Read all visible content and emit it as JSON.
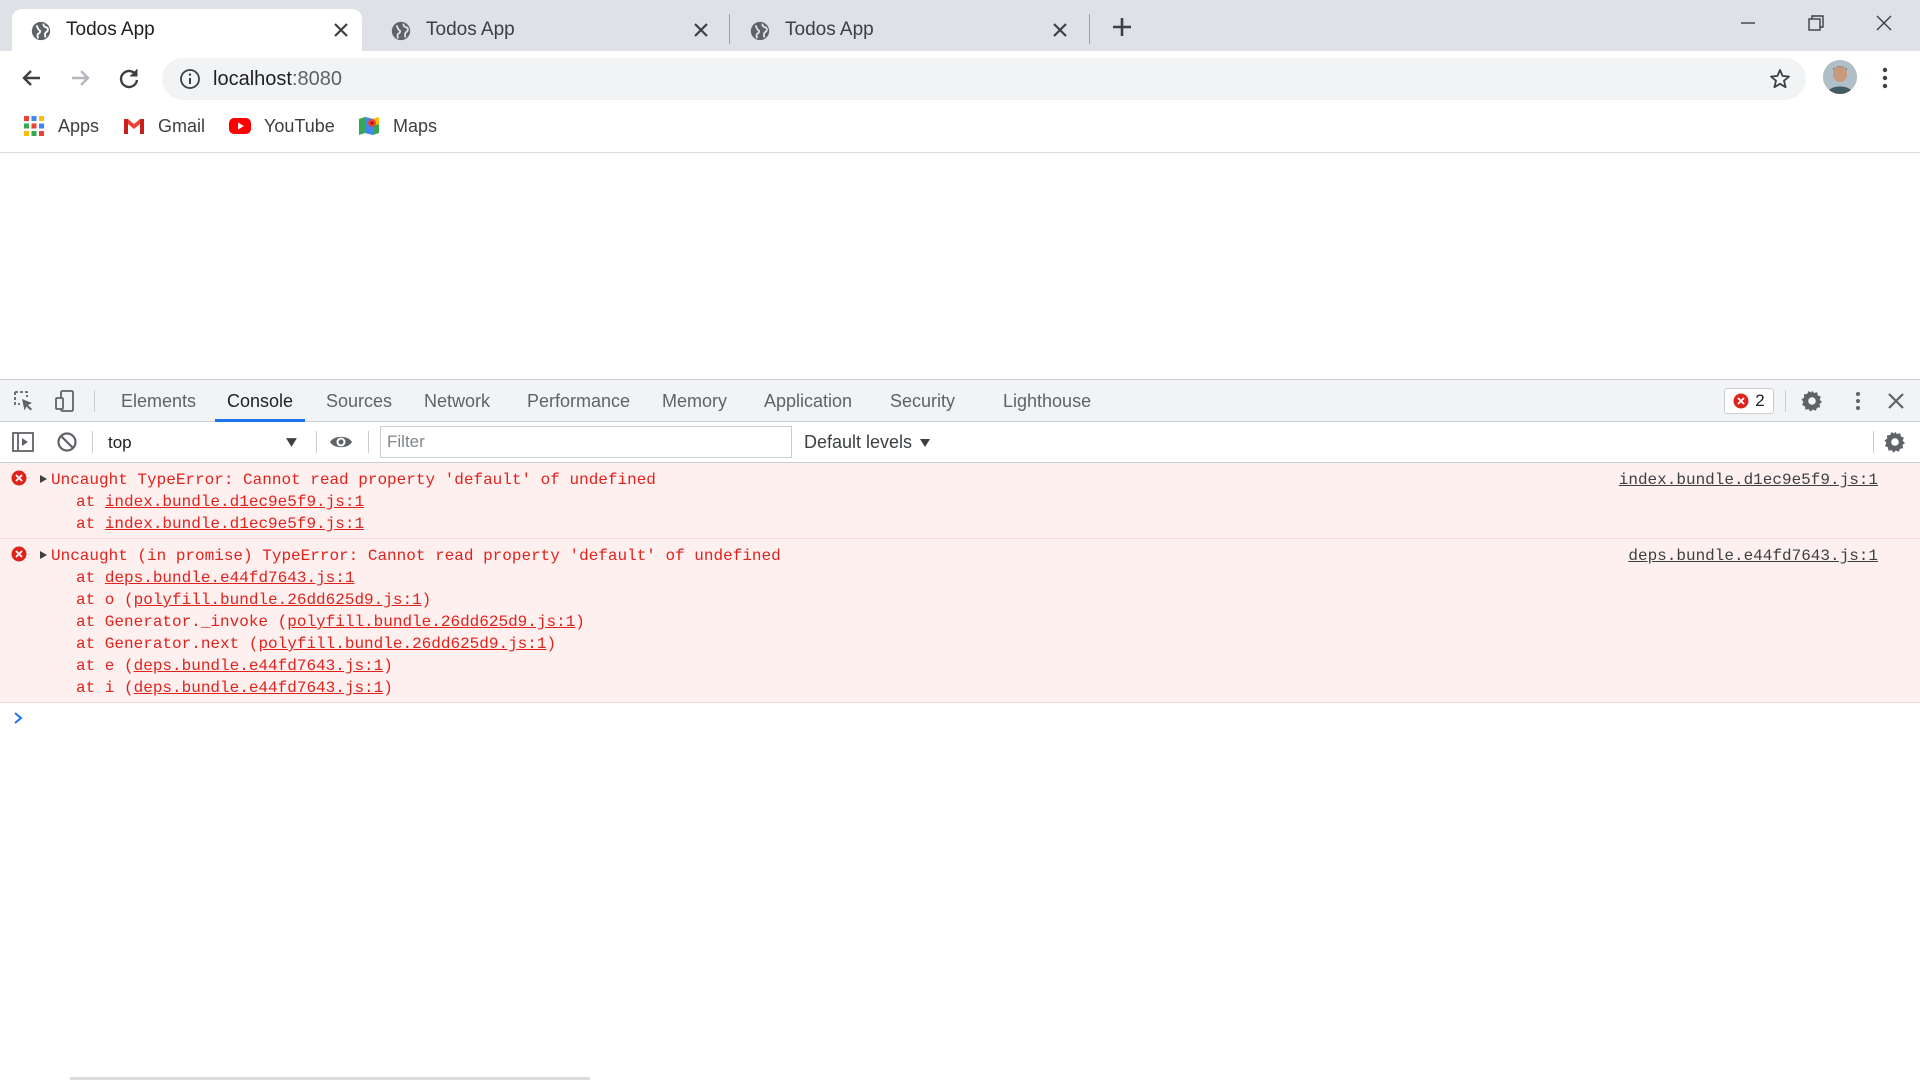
{
  "browser": {
    "tabs": [
      {
        "title": "Todos App",
        "active": true
      },
      {
        "title": "Todos App",
        "active": false
      },
      {
        "title": "Todos App",
        "active": false
      }
    ],
    "url": {
      "host": "localhost",
      "port": ":8080"
    },
    "bookmarks": [
      {
        "label": "Apps",
        "icon": "apps-grid-icon"
      },
      {
        "label": "Gmail",
        "icon": "gmail-icon"
      },
      {
        "label": "YouTube",
        "icon": "youtube-icon"
      },
      {
        "label": "Maps",
        "icon": "maps-icon"
      }
    ]
  },
  "devtools": {
    "tabs": [
      "Elements",
      "Console",
      "Sources",
      "Network",
      "Performance",
      "Memory",
      "Application",
      "Security",
      "Lighthouse"
    ],
    "active_tab": "Console",
    "error_count": "2",
    "context": "top",
    "filter_placeholder": "Filter",
    "levels_label": "Default levels",
    "messages": [
      {
        "text": "Uncaught TypeError: Cannot read property 'default' of undefined",
        "source": "index.bundle.d1ec9e5f9.js:1",
        "stack": [
          {
            "prefix": "at ",
            "link": "index.bundle.d1ec9e5f9.js:1",
            "suffix": ""
          },
          {
            "prefix": "at ",
            "link": "index.bundle.d1ec9e5f9.js:1",
            "suffix": ""
          }
        ]
      },
      {
        "text": "Uncaught (in promise) TypeError: Cannot read property 'default' of undefined",
        "source": "deps.bundle.e44fd7643.js:1",
        "stack": [
          {
            "prefix": "at ",
            "link": "deps.bundle.e44fd7643.js:1",
            "suffix": ""
          },
          {
            "prefix": "at o (",
            "link": "polyfill.bundle.26dd625d9.js:1",
            "suffix": ")"
          },
          {
            "prefix": "at Generator._invoke (",
            "link": "polyfill.bundle.26dd625d9.js:1",
            "suffix": ")"
          },
          {
            "prefix": "at Generator.next (",
            "link": "polyfill.bundle.26dd625d9.js:1",
            "suffix": ")"
          },
          {
            "prefix": "at e (",
            "link": "deps.bundle.e44fd7643.js:1",
            "suffix": ")"
          },
          {
            "prefix": "at i (",
            "link": "deps.bundle.e44fd7643.js:1",
            "suffix": ")"
          }
        ]
      }
    ]
  },
  "colors": {
    "error_red": "#e0221d",
    "error_bg": "#fff0f0",
    "accent_blue": "#1a73e8",
    "tabstrip_bg": "#dee1e6"
  }
}
